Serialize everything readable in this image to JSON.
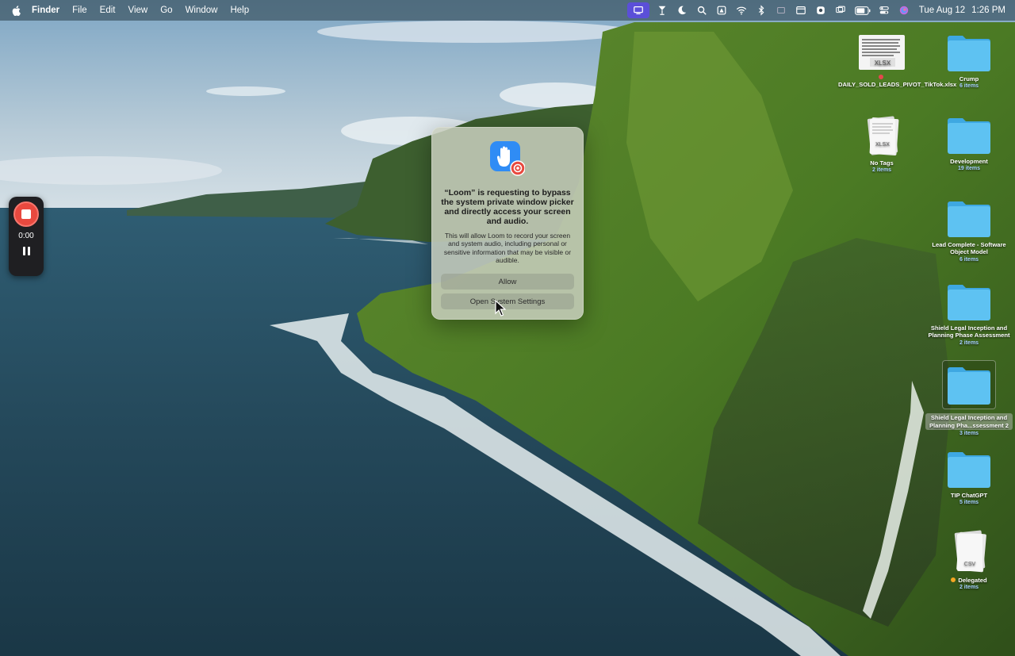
{
  "menubar": {
    "app_name": "Finder",
    "menus": [
      "File",
      "Edit",
      "View",
      "Go",
      "Window",
      "Help"
    ],
    "status_icons": [
      "screen-mirroring-icon",
      "cocktail-icon",
      "moon-icon",
      "search-icon",
      "dot-icon",
      "wifi-icon",
      "bluetooth-icon",
      "grid-icon",
      "window-icon",
      "gear-icon",
      "display-icon",
      "battery-icon",
      "control-center-icon",
      "siri-icon"
    ],
    "date": "Tue Aug 12",
    "time": "1:26 PM"
  },
  "loom": {
    "timer": "0:00"
  },
  "dialog": {
    "title": "“Loom” is requesting to bypass the system private window picker and directly access your screen and audio.",
    "body": "This will allow Loom to record your screen and system audio, including personal or sensitive information that may be visible or audible.",
    "allow_label": "Allow",
    "settings_label": "Open System Settings"
  },
  "desktop": {
    "items": [
      {
        "name": "DAILY_SOLD_LEADS_PIVOT_TikTok.xlsx",
        "count": "",
        "kind": "xlsx",
        "tag_color": "#e5484d",
        "file_label": "XLSX"
      },
      {
        "name": "Crump",
        "count": "6 items",
        "kind": "folder"
      },
      {
        "name": "No Tags",
        "count": "2 items",
        "kind": "xlsx-stack",
        "file_label": "XLSX"
      },
      {
        "name": "Development",
        "count": "19 items",
        "kind": "folder"
      },
      {
        "name": "Lead Complete - Software Object Model",
        "count": "6 items",
        "kind": "folder"
      },
      {
        "name": "Shield Legal Inception and Planning Phase Assessment",
        "count": "2 items",
        "kind": "folder"
      },
      {
        "name": "Shield Legal Inception and Planning Pha...ssessment 2",
        "count": "3 items",
        "kind": "folder",
        "selected": true
      },
      {
        "name": "TIP ChatGPT",
        "count": "5 items",
        "kind": "folder"
      },
      {
        "name": "Delegated",
        "count": "2 items",
        "kind": "csv-stack",
        "tag_color": "#f5a623",
        "file_label": "CSV"
      }
    ]
  },
  "colors": {
    "accent": "#5b4fd8",
    "loom_red": "#e8493f",
    "folder_blue": "#5ec2f2"
  }
}
